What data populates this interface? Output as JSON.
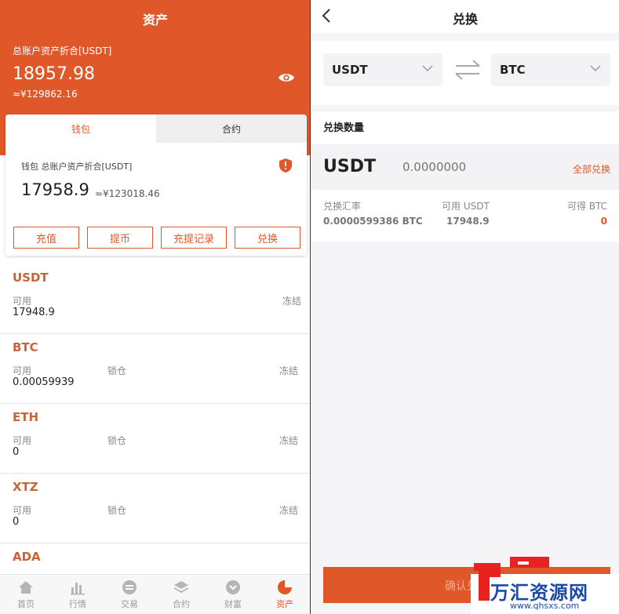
{
  "left": {
    "header_title": "资产",
    "total_label": "总账户资产折合[USDT]",
    "total_amount": "18957.98",
    "total_cny": "≈¥129862.16",
    "card": {
      "tabs": [
        "钱包",
        "合约"
      ],
      "label": "钱包 总账户资产折合[USDT]",
      "amount": "17958.9",
      "cny": "≈¥123018.46",
      "buttons": [
        "充值",
        "提币",
        "充提记录",
        "兑换"
      ]
    },
    "col_available": "可用",
    "col_locked": "锁仓",
    "col_frozen": "冻结",
    "assets": [
      {
        "name": "USDT",
        "available": "17948.9"
      },
      {
        "name": "BTC",
        "available": "0.00059939"
      },
      {
        "name": "ETH",
        "available": "0"
      },
      {
        "name": "XTZ",
        "available": "0"
      },
      {
        "name": "ADA",
        "available": ""
      }
    ],
    "tabbar": [
      "首页",
      "行情",
      "交易",
      "合约",
      "财富",
      "资产"
    ]
  },
  "right": {
    "title": "兑换",
    "from_coin": "USDT",
    "to_coin": "BTC",
    "qty_label": "兑换数量",
    "qty_coin": "USDT",
    "qty_placeholder": "0.0000000",
    "all_label": "全部兑换",
    "rate_label": "兑换汇率",
    "rate_value": "0.0000599386 BTC",
    "avail_label": "可用 USDT",
    "avail_value": "17948.9",
    "get_label": "可得 BTC",
    "get_value": "0",
    "confirm_label": "确认兑换"
  },
  "watermark": {
    "text": "万汇资源网",
    "url": "www.qhsxs.com"
  },
  "colors": {
    "accent": "#e0582a",
    "asset_name": "#c9643a",
    "watermark_red": "#e8221f",
    "watermark_blue": "#1c4aa8"
  }
}
